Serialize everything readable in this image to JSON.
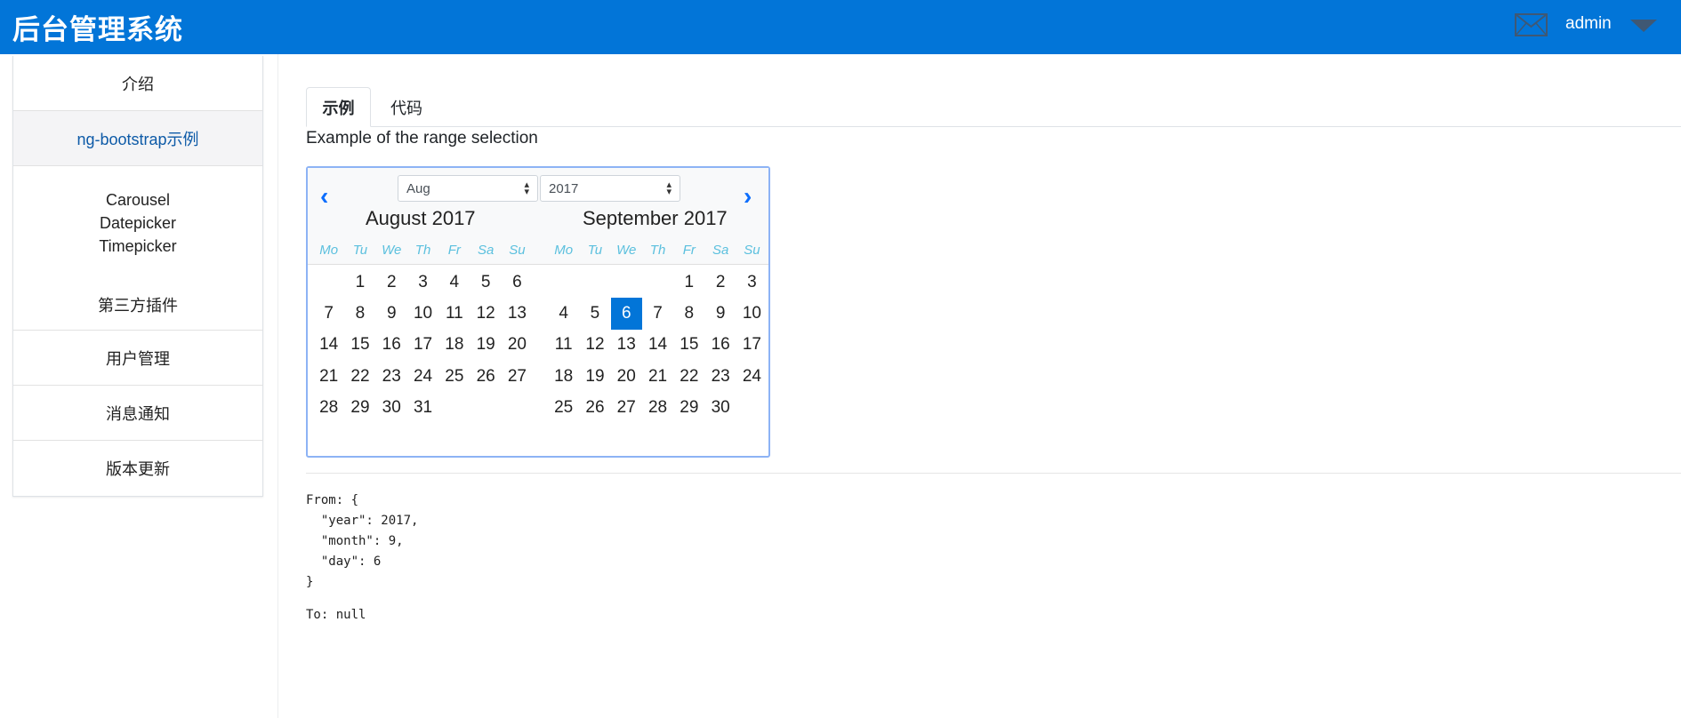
{
  "header": {
    "brand": "后台管理系统",
    "user": "admin",
    "bg_color": "#0275d8",
    "icons": [
      "mail-icon",
      "caret-down-icon"
    ]
  },
  "sidebar": {
    "items": [
      {
        "label": "介绍"
      },
      {
        "label": "ng-bootstrap示例",
        "active": true
      },
      {
        "sub": [
          "Carousel",
          "Datepicker",
          "Timepicker"
        ]
      },
      {
        "label": "第三方插件"
      },
      {
        "label": "用户管理"
      },
      {
        "label": "消息通知"
      },
      {
        "label": "版本更新"
      }
    ]
  },
  "tabs": [
    {
      "label": "示例",
      "active": true
    },
    {
      "label": "代码"
    }
  ],
  "description": "Example of the range selection",
  "datepicker": {
    "month_select": "Aug",
    "year_select": "2017",
    "months": [
      {
        "title": "August 2017",
        "weekdays": [
          "Mo",
          "Tu",
          "We",
          "Th",
          "Fr",
          "Sa",
          "Su"
        ],
        "days": [
          "",
          "1",
          "2",
          "3",
          "4",
          "5",
          "6",
          "7",
          "8",
          "9",
          "10",
          "11",
          "12",
          "13",
          "14",
          "15",
          "16",
          "17",
          "18",
          "19",
          "20",
          "21",
          "22",
          "23",
          "24",
          "25",
          "26",
          "27",
          "28",
          "29",
          "30",
          "31"
        ]
      },
      {
        "title": "September 2017",
        "weekdays": [
          "Mo",
          "Tu",
          "We",
          "Th",
          "Fr",
          "Sa",
          "Su"
        ],
        "days": [
          "",
          "",
          "",
          "",
          "1",
          "2",
          "3",
          "4",
          "5",
          "6",
          "7",
          "8",
          "9",
          "10",
          "11",
          "12",
          "13",
          "14",
          "15",
          "16",
          "17",
          "18",
          "19",
          "20",
          "21",
          "22",
          "23",
          "24",
          "25",
          "26",
          "27",
          "28",
          "29",
          "30"
        ],
        "selected": "6"
      }
    ],
    "selected_color": "#0275d8"
  },
  "output": {
    "from_text": "From: {\n  \"year\": 2017,\n  \"month\": 9,\n  \"day\": 6\n}",
    "to_text": "To: null"
  }
}
